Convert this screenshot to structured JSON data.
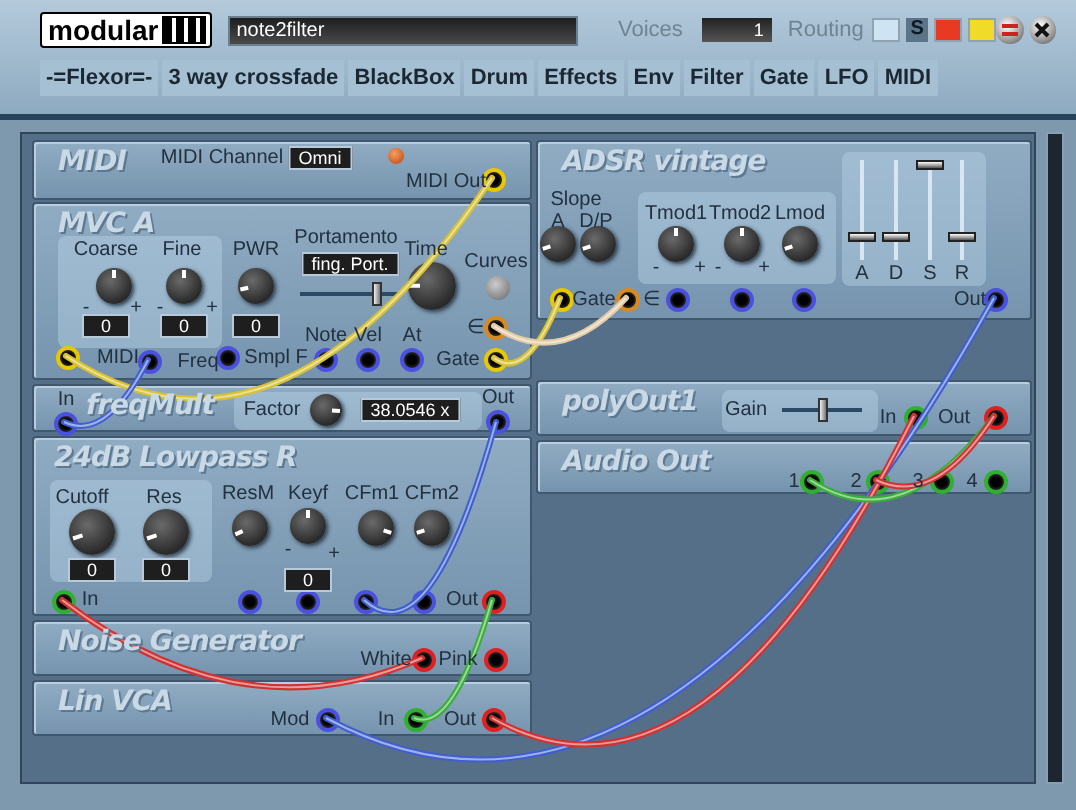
{
  "header": {
    "logo": "modular",
    "patch_name": "note2filter",
    "voices_label": "Voices",
    "voices": "1",
    "routing_label": "Routing",
    "routing": [
      {
        "kind": "swatch",
        "color": "#cfe4f2"
      },
      {
        "kind": "letter",
        "label": "S"
      },
      {
        "kind": "swatch",
        "color": "#e83a22"
      },
      {
        "kind": "swatch",
        "color": "#f0dc28"
      }
    ]
  },
  "categories": [
    "-=Flexor=-",
    "3 way crossfade",
    "BlackBox",
    "Drum",
    "Effects",
    "Env",
    "Filter",
    "Gate",
    "LFO",
    "MIDI"
  ],
  "modules": [
    {
      "title": "MIDI",
      "controls": [
        {
          "kind": "label",
          "text": "MIDI Channel"
        },
        {
          "kind": "display",
          "text": "Omni"
        },
        {
          "kind": "led"
        },
        {
          "kind": "label",
          "text": "MIDI Out"
        },
        {
          "kind": "jack",
          "color": "#e8c800"
        }
      ]
    },
    {
      "title": "MVC A",
      "controls": [
        {
          "kind": "label",
          "text": "Coarse"
        },
        {
          "kind": "knob",
          "level": 0.5
        },
        {
          "kind": "label",
          "text": "-"
        },
        {
          "kind": "label",
          "text": "+"
        },
        {
          "kind": "display",
          "text": "0"
        },
        {
          "kind": "label",
          "text": "Fine"
        },
        {
          "kind": "knob",
          "level": 0.5
        },
        {
          "kind": "label",
          "text": "-"
        },
        {
          "kind": "label",
          "text": "+"
        },
        {
          "kind": "display",
          "text": "0"
        },
        {
          "kind": "label",
          "text": "PWR"
        },
        {
          "kind": "knob",
          "level": 0.12
        },
        {
          "kind": "display",
          "text": "0"
        },
        {
          "kind": "label",
          "text": "Portamento"
        },
        {
          "kind": "display",
          "text": "fing. Port."
        },
        {
          "kind": "slider",
          "level": 0.75
        },
        {
          "kind": "label",
          "text": "Time"
        },
        {
          "kind": "knob",
          "level": 0.17
        },
        {
          "kind": "label",
          "text": "Curves"
        },
        {
          "kind": "button"
        },
        {
          "kind": "label",
          "text": "∈"
        },
        {
          "kind": "jack",
          "color": "#d88a20"
        },
        {
          "kind": "label",
          "text": "Note"
        },
        {
          "kind": "label",
          "text": "Vel"
        },
        {
          "kind": "label",
          "text": "At"
        },
        {
          "kind": "jack",
          "color": "#e8c800"
        },
        {
          "kind": "label",
          "text": "MIDI"
        },
        {
          "kind": "jack",
          "color": "#4a50e0"
        },
        {
          "kind": "label",
          "text": "Freq"
        },
        {
          "kind": "jack",
          "color": "#4a50e0"
        },
        {
          "kind": "label",
          "text": "Smpl F"
        },
        {
          "kind": "jack",
          "color": "#4a50e0"
        },
        {
          "kind": "jack",
          "color": "#4a50e0"
        },
        {
          "kind": "jack",
          "color": "#4a50e0"
        },
        {
          "kind": "label",
          "text": "Gate"
        },
        {
          "kind": "jack",
          "color": "#e8c800"
        }
      ]
    },
    {
      "title": "freqMult",
      "controls": [
        {
          "kind": "label",
          "text": "In"
        },
        {
          "kind": "jack",
          "color": "#4a50e0"
        },
        {
          "kind": "label",
          "text": "Factor"
        },
        {
          "kind": "knob",
          "level": 0.85
        },
        {
          "kind": "display",
          "text": "38.0546 x"
        },
        {
          "kind": "label",
          "text": "Out"
        },
        {
          "kind": "jack",
          "color": "#4a50e0"
        }
      ]
    },
    {
      "title": "24dB Lowpass R",
      "controls": [
        {
          "kind": "label",
          "text": "Cutoff"
        },
        {
          "kind": "knob",
          "level": 0.1
        },
        {
          "kind": "display",
          "text": "0"
        },
        {
          "kind": "label",
          "text": "Res"
        },
        {
          "kind": "knob",
          "level": 0.1
        },
        {
          "kind": "display",
          "text": "0"
        },
        {
          "kind": "label",
          "text": "ResM"
        },
        {
          "kind": "knob",
          "level": 0.08
        },
        {
          "kind": "label",
          "text": "Keyf"
        },
        {
          "kind": "knob",
          "level": 0.5
        },
        {
          "kind": "label",
          "text": "-"
        },
        {
          "kind": "label",
          "text": "+"
        },
        {
          "kind": "display",
          "text": "0"
        },
        {
          "kind": "label",
          "text": "CFm1"
        },
        {
          "kind": "knob",
          "level": 0.9
        },
        {
          "kind": "label",
          "text": "CFm2"
        },
        {
          "kind": "knob",
          "level": 0.1
        },
        {
          "kind": "jack",
          "color": "#30b030"
        },
        {
          "kind": "label",
          "text": "In"
        },
        {
          "kind": "jack",
          "color": "#4a50e0"
        },
        {
          "kind": "jack",
          "color": "#4a50e0"
        },
        {
          "kind": "jack",
          "color": "#4a50e0"
        },
        {
          "kind": "jack",
          "color": "#4a50e0"
        },
        {
          "kind": "label",
          "text": "Out"
        },
        {
          "kind": "jack",
          "color": "#e02020"
        }
      ]
    },
    {
      "title": "Noise Generator",
      "controls": [
        {
          "kind": "label",
          "text": "White"
        },
        {
          "kind": "jack",
          "color": "#e02020"
        },
        {
          "kind": "label",
          "text": "Pink"
        },
        {
          "kind": "jack",
          "color": "#e02020"
        }
      ]
    },
    {
      "title": "Lin VCA",
      "controls": [
        {
          "kind": "label",
          "text": "Mod"
        },
        {
          "kind": "jack",
          "color": "#4a50e0"
        },
        {
          "kind": "label",
          "text": "In"
        },
        {
          "kind": "jack",
          "color": "#30b030"
        },
        {
          "kind": "label",
          "text": "Out"
        },
        {
          "kind": "jack",
          "color": "#e02020"
        }
      ]
    },
    {
      "title": "ADSR vintage",
      "controls": [
        {
          "kind": "label",
          "text": "Slope"
        },
        {
          "kind": "label",
          "text": "A"
        },
        {
          "kind": "label",
          "text": "D/P"
        },
        {
          "kind": "knob",
          "level": 0.1
        },
        {
          "kind": "knob",
          "level": 0.1
        },
        {
          "kind": "label",
          "text": "Tmod1"
        },
        {
          "kind": "knob",
          "level": 0.5
        },
        {
          "kind": "label",
          "text": "-"
        },
        {
          "kind": "label",
          "text": "+"
        },
        {
          "kind": "label",
          "text": "Tmod2"
        },
        {
          "kind": "knob",
          "level": 0.5
        },
        {
          "kind": "label",
          "text": "-"
        },
        {
          "kind": "label",
          "text": "+"
        },
        {
          "kind": "label",
          "text": "Lmod"
        },
        {
          "kind": "knob",
          "level": 0.1
        },
        {
          "kind": "fader",
          "level": 0.2
        },
        {
          "kind": "fader",
          "level": 0.2
        },
        {
          "kind": "fader",
          "level": 1
        },
        {
          "kind": "fader",
          "level": 0.2
        },
        {
          "kind": "label",
          "text": "A"
        },
        {
          "kind": "label",
          "text": "D"
        },
        {
          "kind": "label",
          "text": "S"
        },
        {
          "kind": "label",
          "text": "R"
        },
        {
          "kind": "jack",
          "color": "#e8c800"
        },
        {
          "kind": "label",
          "text": "Gate"
        },
        {
          "kind": "jack",
          "color": "#d88a20"
        },
        {
          "kind": "label",
          "text": "∈"
        },
        {
          "kind": "jack",
          "color": "#4a50e0"
        },
        {
          "kind": "jack",
          "color": "#4a50e0"
        },
        {
          "kind": "jack",
          "color": "#4a50e0"
        },
        {
          "kind": "label",
          "text": "Out"
        },
        {
          "kind": "jack",
          "color": "#4a50e0"
        }
      ]
    },
    {
      "title": "polyOut1",
      "controls": [
        {
          "kind": "label",
          "text": "Gain"
        },
        {
          "kind": "slider",
          "level": 0.5
        },
        {
          "kind": "label",
          "text": "In"
        },
        {
          "kind": "jack",
          "color": "#30b030"
        },
        {
          "kind": "label",
          "text": "Out"
        },
        {
          "kind": "jack",
          "color": "#e02020"
        }
      ]
    },
    {
      "title": "Audio Out",
      "controls": [
        {
          "kind": "label",
          "text": "1"
        },
        {
          "kind": "jack",
          "color": "#30b030"
        },
        {
          "kind": "label",
          "text": "2"
        },
        {
          "kind": "jack",
          "color": "#30b030"
        },
        {
          "kind": "label",
          "text": "3"
        },
        {
          "kind": "jack",
          "color": "#30b030"
        },
        {
          "kind": "label",
          "text": "4"
        },
        {
          "kind": "jack",
          "color": "#30b030"
        }
      ]
    }
  ]
}
